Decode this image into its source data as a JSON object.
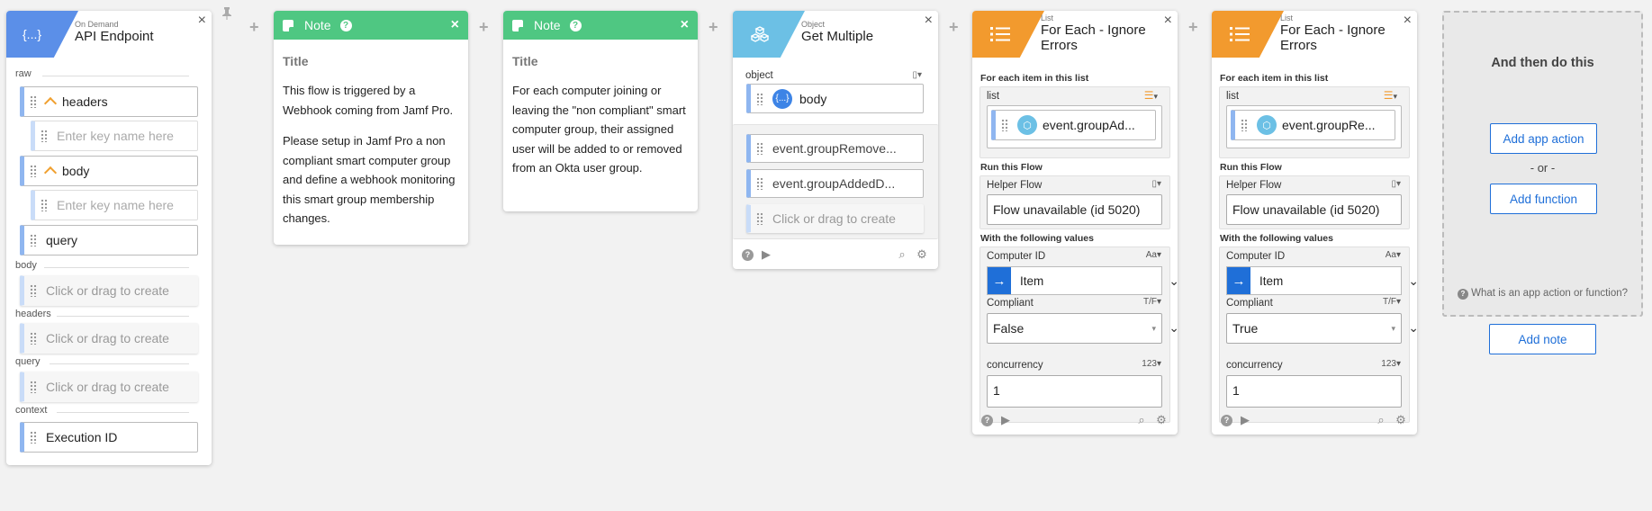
{
  "api_card": {
    "sub": "On Demand",
    "title": "API Endpoint",
    "sections": {
      "raw": "raw",
      "body": "body",
      "headers": "headers",
      "query": "query",
      "context": "context"
    },
    "fields": {
      "headers": "headers",
      "body": "body",
      "query": "query",
      "execution_id": "Execution ID"
    },
    "key_placeholder": "Enter key name here",
    "create_placeholder": "Click or drag to create",
    "close": "×"
  },
  "note1": {
    "header": "Note",
    "title": "Title",
    "paragraphs": [
      "This flow is triggered by a Webhook coming from Jamf Pro.",
      "Please setup in Jamf Pro a non compliant smart computer group and define a webhook monitoring this smart group membership changes."
    ]
  },
  "note2": {
    "header": "Note",
    "title": "Title",
    "paragraphs": [
      "For each computer joining or leaving the \"non compliant\" smart computer group, their assigned user will be added to or removed from an Okta user group."
    ]
  },
  "object_card": {
    "sub": "Object",
    "title": "Get Multiple",
    "object_label": "object",
    "object_value": "body",
    "items": [
      "event.groupRemove...",
      "event.groupAddedD..."
    ],
    "create_placeholder": "Click or drag to create"
  },
  "foreach1": {
    "sub": "List",
    "title_line1": "For Each - Ignore",
    "title_line2": "Errors",
    "for_each_label": "For each item in this list",
    "list_label": "list",
    "list_value": "event.groupAd...",
    "run_label": "Run this Flow",
    "helper_label": "Helper Flow",
    "helper_value": "Flow unavailable (id 5020)",
    "values_label": "With the following values",
    "computer_label": "Computer ID",
    "computer_type": "Aa",
    "computer_value": "Item",
    "compliant_label": "Compliant",
    "compliant_type": "T/F",
    "compliant_value": "False",
    "concurrency_label": "concurrency",
    "concurrency_type": "123",
    "concurrency_value": "1"
  },
  "foreach2": {
    "sub": "List",
    "title_line1": "For Each - Ignore",
    "title_line2": "Errors",
    "for_each_label": "For each item in this list",
    "list_label": "list",
    "list_value": "event.groupRe...",
    "run_label": "Run this Flow",
    "helper_label": "Helper Flow",
    "helper_value": "Flow unavailable (id 5020)",
    "values_label": "With the following values",
    "computer_label": "Computer ID",
    "computer_type": "Aa",
    "computer_value": "Item",
    "compliant_label": "Compliant",
    "compliant_type": "T/F",
    "compliant_value": "True",
    "concurrency_label": "concurrency",
    "concurrency_type": "123",
    "concurrency_value": "1"
  },
  "next_panel": {
    "title": "And then do this",
    "add_app_action": "Add app action",
    "or": "- or -",
    "add_function": "Add function",
    "help": "What is an app action or function?",
    "add_note": "Add note"
  },
  "colors": {
    "api_tile": "#5b8fe8",
    "note_header": "#4fc782",
    "object_tile": "#6cc0e5",
    "list_tile": "#f29a2e",
    "accent_blue": "#1f6fd8"
  }
}
